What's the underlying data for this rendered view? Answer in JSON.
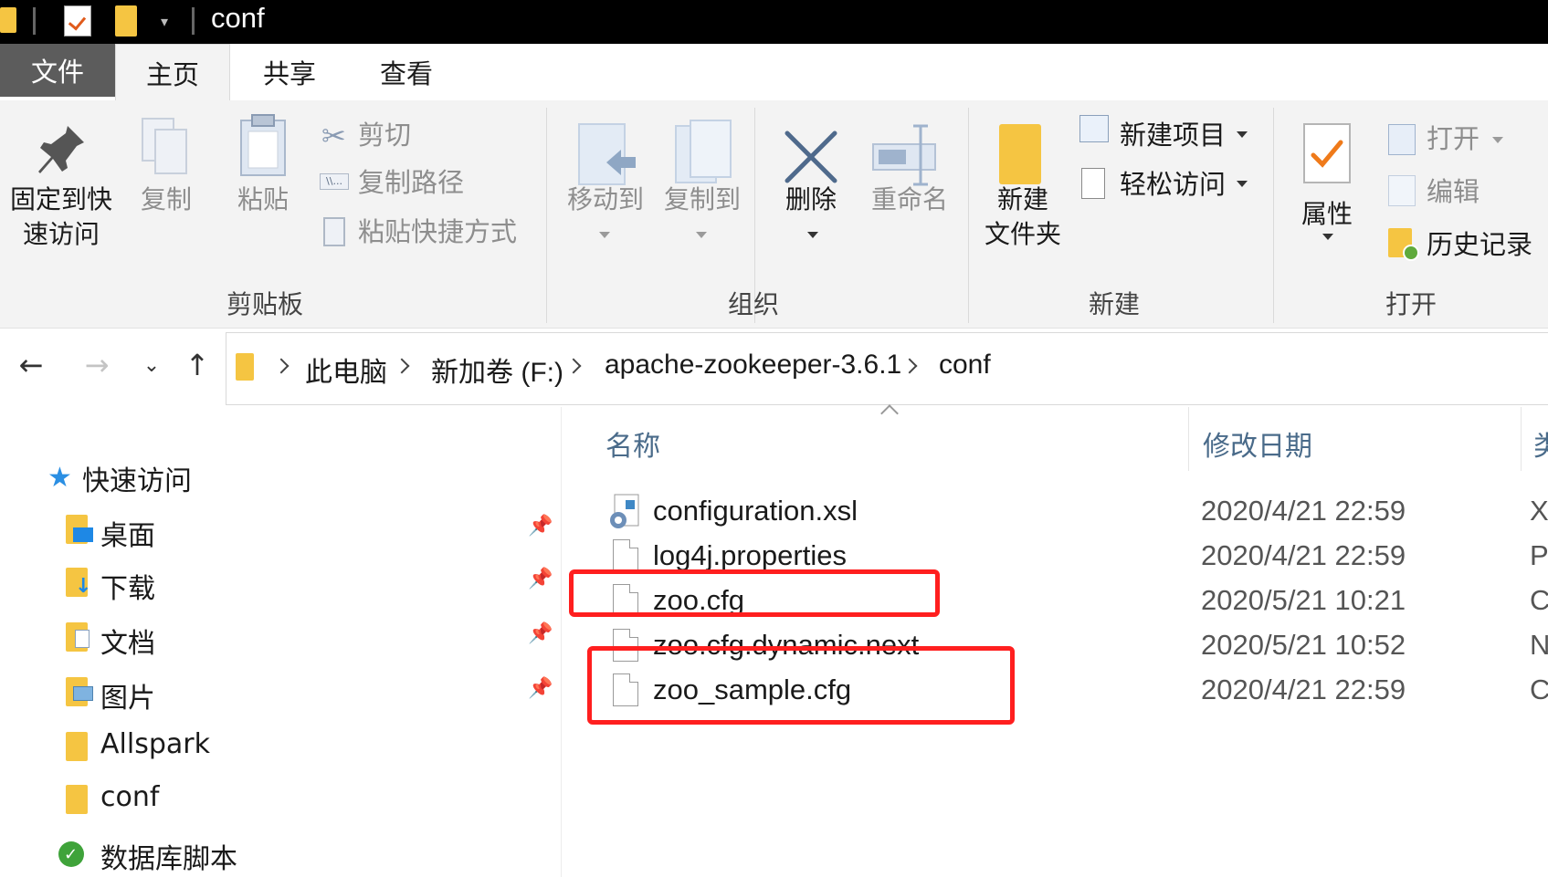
{
  "window": {
    "title": "conf"
  },
  "tabs": {
    "file": "文件",
    "home": "主页",
    "share": "共享",
    "view": "查看"
  },
  "ribbon": {
    "clipboard": {
      "pin_label_1": "固定到快",
      "pin_label_2": "速访问",
      "copy": "复制",
      "paste": "粘贴",
      "cut": "剪切",
      "copy_path": "复制路径",
      "paste_shortcut": "粘贴快捷方式",
      "group": "剪贴板"
    },
    "organize": {
      "move_to": "移动到",
      "copy_to": "复制到",
      "delete": "删除",
      "rename": "重命名",
      "group": "组织"
    },
    "new": {
      "new_folder_1": "新建",
      "new_folder_2": "文件夹",
      "new_item": "新建项目",
      "easy_access": "轻松访问",
      "group": "新建"
    },
    "open": {
      "properties": "属性",
      "open": "打开",
      "edit": "编辑",
      "history": "历史记录",
      "group": "打开"
    }
  },
  "breadcrumb": [
    "此电脑",
    "新加卷 (F:)",
    "apache-zookeeper-3.6.1",
    "conf"
  ],
  "nav": {
    "quick_access": "快速访问",
    "items": [
      "桌面",
      "下载",
      "文档",
      "图片",
      "Allspark",
      "conf",
      "数据库脚本"
    ]
  },
  "columns": {
    "name": "名称",
    "modified": "修改日期",
    "type": "类"
  },
  "files": [
    {
      "name": "configuration.xsl",
      "date": "2020/4/21 22:59",
      "type": "X"
    },
    {
      "name": "log4j.properties",
      "date": "2020/4/21 22:59",
      "type": "P"
    },
    {
      "name": "zoo.cfg",
      "date": "2020/5/21 10:21",
      "type": "C"
    },
    {
      "name": "zoo.cfg.dynamic.next",
      "date": "2020/5/21 10:52",
      "type": "N"
    },
    {
      "name": "zoo_sample.cfg",
      "date": "2020/4/21 22:59",
      "type": "C"
    }
  ],
  "colors": {
    "highlight": "#ff1f1f",
    "folder": "#f5c542",
    "column_header": "#4a6b8a",
    "file_tab": "#5c5c5c"
  }
}
